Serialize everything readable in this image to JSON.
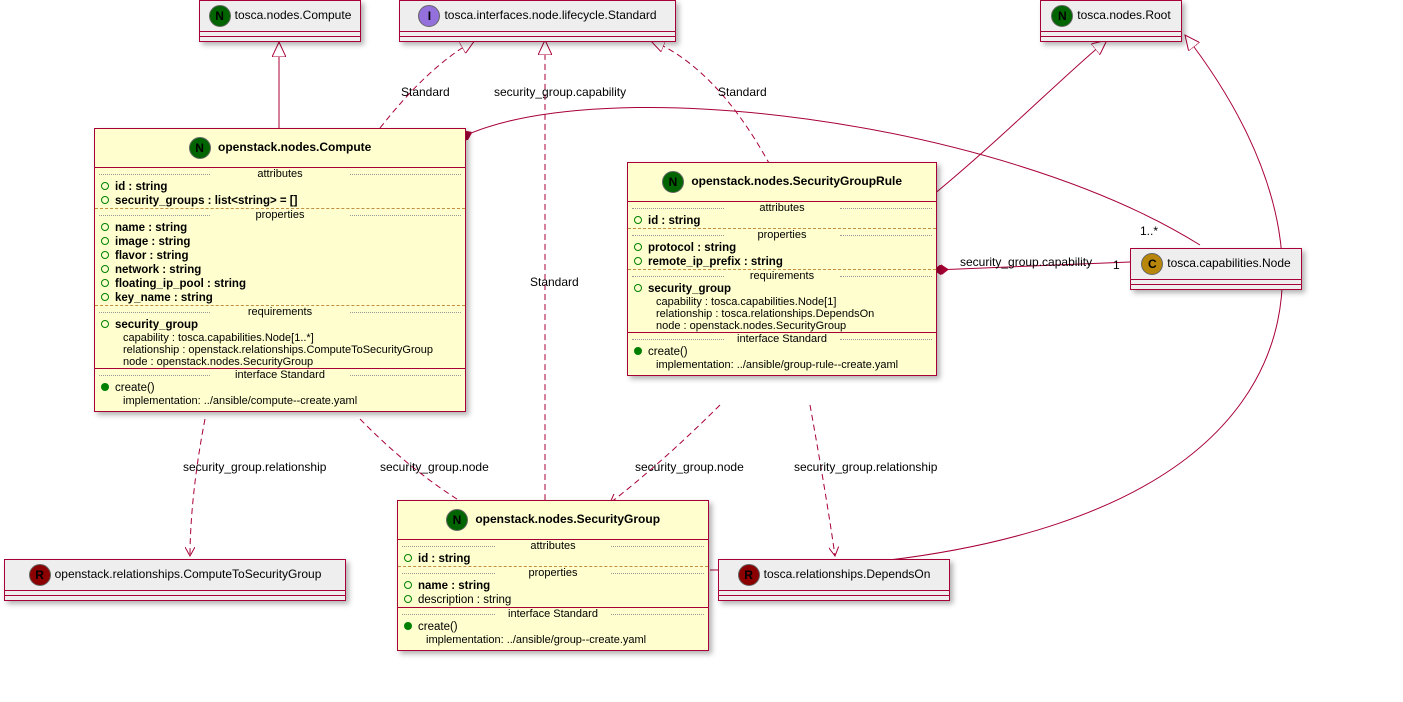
{
  "top": {
    "compute": "tosca.nodes.Compute",
    "lifecycle": "tosca.interfaces.node.lifecycle.Standard",
    "root": "tosca.nodes.Root"
  },
  "capabilityNode": "tosca.capabilities.Node",
  "compute": {
    "title": "openstack.nodes.Compute",
    "sections": {
      "attributes": "attributes",
      "properties": "properties",
      "requirements": "requirements",
      "interface": "interface Standard"
    },
    "attrs": {
      "id": "id : string",
      "sg": "security_groups : list<string> = []"
    },
    "props": {
      "name": "name : string",
      "image": "image : string",
      "flavor": "flavor : string",
      "network": "network : string",
      "fip": "floating_ip_pool : string",
      "keyname": "key_name : string"
    },
    "req": {
      "name": "security_group",
      "cap": "capability : tosca.capabilities.Node[1..*]",
      "rel": "relationship : openstack.relationships.ComputeToSecurityGroup",
      "node": "node : openstack.nodes.SecurityGroup"
    },
    "iface": {
      "create": "create()",
      "impl": "implementation: ../ansible/compute--create.yaml"
    }
  },
  "sgrule": {
    "title": "openstack.nodes.SecurityGroupRule",
    "sections": {
      "attributes": "attributes",
      "properties": "properties",
      "requirements": "requirements",
      "interface": "interface Standard"
    },
    "attrs": {
      "id": "id : string"
    },
    "props": {
      "protocol": "protocol : string",
      "remote": "remote_ip_prefix : string"
    },
    "req": {
      "name": "security_group",
      "cap": "capability : tosca.capabilities.Node[1]",
      "rel": "relationship : tosca.relationships.DependsOn",
      "node": "node : openstack.nodes.SecurityGroup"
    },
    "iface": {
      "create": "create()",
      "impl": "implementation: ../ansible/group-rule--create.yaml"
    }
  },
  "sg": {
    "title": "openstack.nodes.SecurityGroup",
    "sections": {
      "attributes": "attributes",
      "properties": "properties",
      "interface": "interface Standard"
    },
    "attrs": {
      "id": "id : string"
    },
    "props": {
      "name": "name : string",
      "desc": "description : string"
    },
    "iface": {
      "create": "create()",
      "impl": "implementation: ../ansible/group--create.yaml"
    }
  },
  "rel": {
    "c2sg": "openstack.relationships.ComputeToSecurityGroup",
    "dependson": "tosca.relationships.DependsOn"
  },
  "labels": {
    "standard": "Standard",
    "sg_cap": "security_group.capability",
    "sg_rel": "security_group.relationship",
    "sg_node": "security_group.node",
    "mult_multi": "1..*",
    "mult_1": "1"
  }
}
